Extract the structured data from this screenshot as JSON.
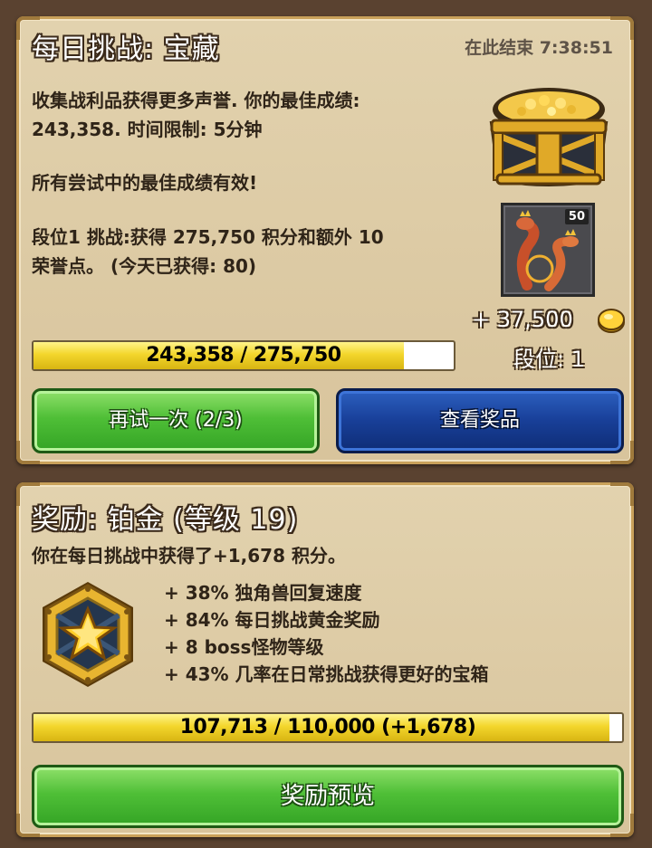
{
  "challenge": {
    "title": "每日挑战: 宝藏",
    "ends_in": "在此结束 7:38:51",
    "description_line1": "收集战利品获得更多声誉. 你的最佳成绩:",
    "description_line2": "243,358. 时间限制: 5分钟",
    "best_counts": "所有尝试中的最佳成绩有效!",
    "tier_line1": "段位1 挑战:获得 275,750 积分和额外 10",
    "tier_line2": "荣誉点。 (今天已获得: 80)",
    "progress_label": "243,358 / 275,750",
    "progress_fraction": 0.8825,
    "monster_level_badge": "50",
    "reward_amount": "+ 37,500",
    "tier_label": "段位: 1",
    "retry_button": "再试一次 (2/3)",
    "view_prizes_button": "查看奖品",
    "chest_icon": "treasure-chest-icon",
    "monster_icon": "two-headed-dragon-icon",
    "coin_icon": "gold-coin-icon"
  },
  "reward": {
    "title": "奖励: 铂金 (等级 19)",
    "earned_text": "你在每日挑战中获得了+1,678 积分。",
    "bonuses": [
      "+ 38% 独角兽回复速度",
      "+ 84% 每日挑战黄金奖励",
      "+ 8 boss怪物等级",
      "+ 43% 几率在日常挑战获得更好的宝箱"
    ],
    "progress_label": "107,713 / 110,000 (+1,678)",
    "progress_fraction": 0.979,
    "preview_button": "奖励预览",
    "badge_icon": "star-medal-icon"
  },
  "colors": {
    "panel_bg": "#ddcaa3",
    "progress_fill": "#f3d62c",
    "green_button": "#4fbf37",
    "blue_button": "#183f98"
  }
}
